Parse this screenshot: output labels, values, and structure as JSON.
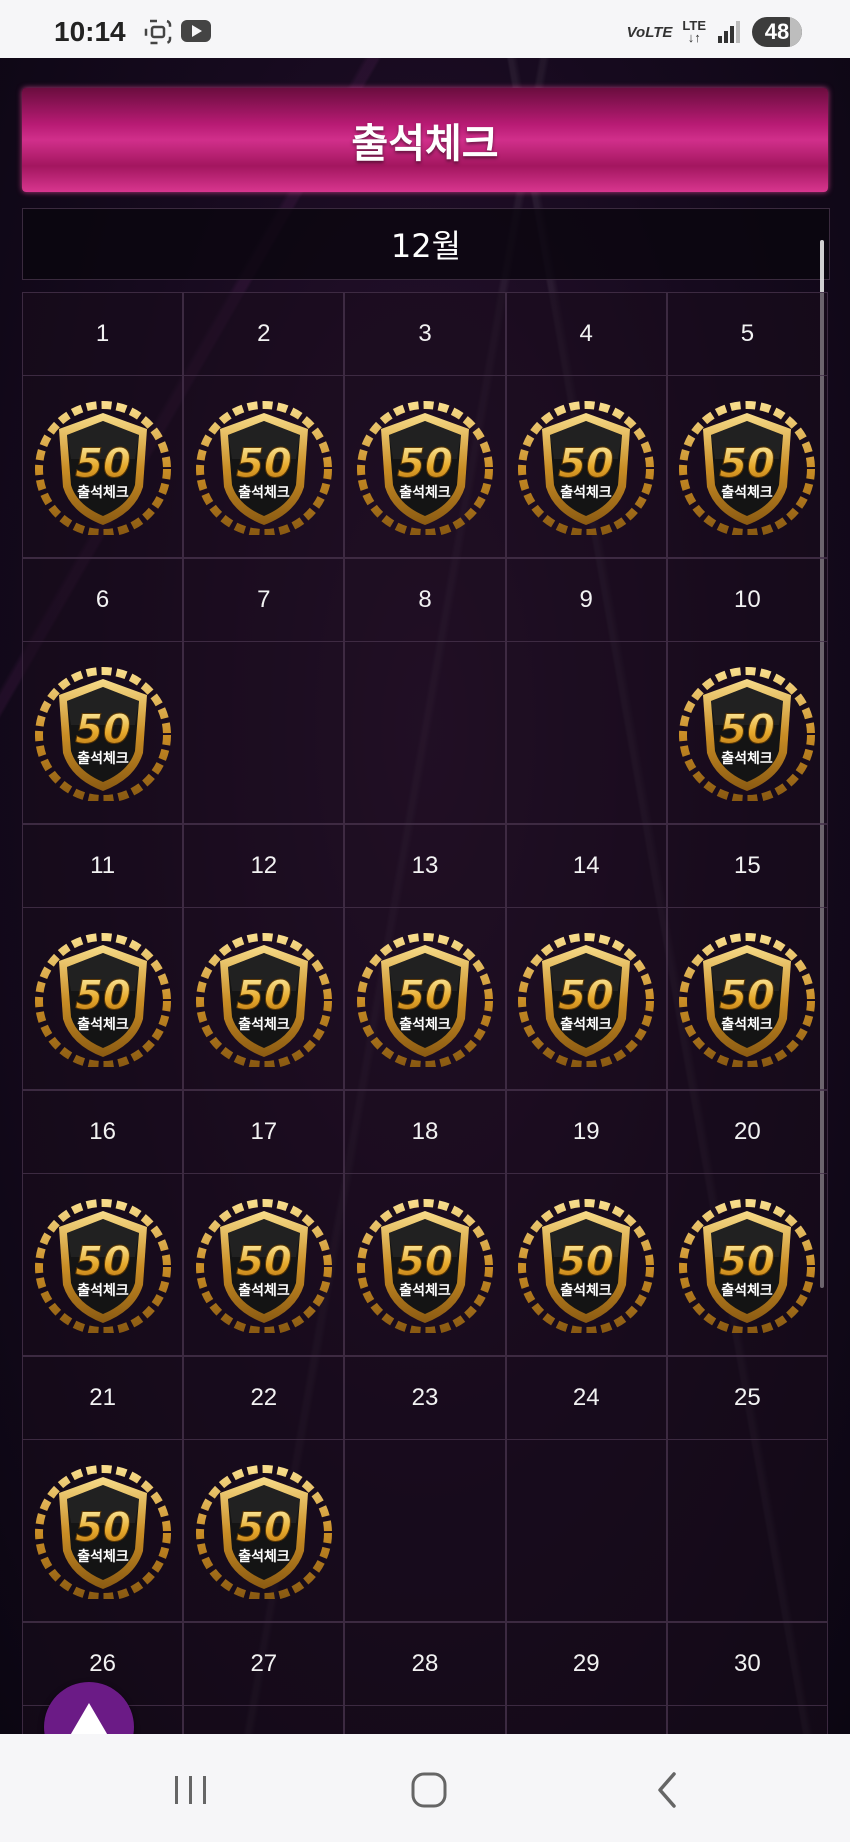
{
  "status_bar": {
    "time": "10:14",
    "network_label": "VoLTE",
    "lte_label": "LTE",
    "battery": "48"
  },
  "page": {
    "title": "출석체크",
    "month": "12월"
  },
  "badge": {
    "value": "50",
    "caption": "출석체크"
  },
  "calendar": {
    "days": [
      {
        "day": "1",
        "checked": true
      },
      {
        "day": "2",
        "checked": true
      },
      {
        "day": "3",
        "checked": true
      },
      {
        "day": "4",
        "checked": true
      },
      {
        "day": "5",
        "checked": true
      },
      {
        "day": "6",
        "checked": true
      },
      {
        "day": "7",
        "checked": false
      },
      {
        "day": "8",
        "checked": false
      },
      {
        "day": "9",
        "checked": false
      },
      {
        "day": "10",
        "checked": true
      },
      {
        "day": "11",
        "checked": true
      },
      {
        "day": "12",
        "checked": true
      },
      {
        "day": "13",
        "checked": true
      },
      {
        "day": "14",
        "checked": true
      },
      {
        "day": "15",
        "checked": true
      },
      {
        "day": "16",
        "checked": true
      },
      {
        "day": "17",
        "checked": true
      },
      {
        "day": "18",
        "checked": true
      },
      {
        "day": "19",
        "checked": true
      },
      {
        "day": "20",
        "checked": true
      },
      {
        "day": "21",
        "checked": true
      },
      {
        "day": "22",
        "checked": true
      },
      {
        "day": "23",
        "checked": false
      },
      {
        "day": "24",
        "checked": false
      },
      {
        "day": "25",
        "checked": false
      },
      {
        "day": "26",
        "checked": false
      },
      {
        "day": "27",
        "checked": false
      },
      {
        "day": "28",
        "checked": false
      },
      {
        "day": "29",
        "checked": false
      },
      {
        "day": "30",
        "checked": false
      }
    ]
  },
  "icons": {
    "scroll_top": "triangle-up-icon",
    "nav_recent": "recent-apps-icon",
    "nav_home": "home-icon",
    "nav_back": "back-icon"
  },
  "colors": {
    "title_banner": "#c3237f",
    "up_button": "#6b1b86",
    "badge_gold": "#d9a93c"
  }
}
